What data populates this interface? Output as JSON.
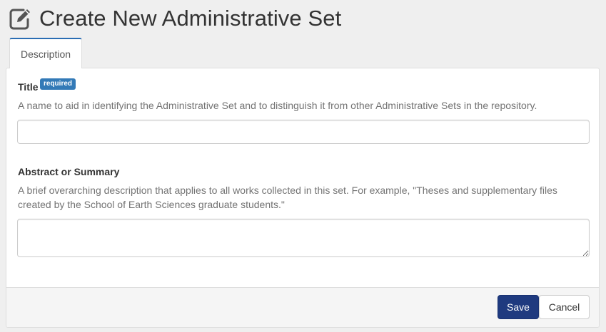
{
  "header": {
    "title": "Create New Administrative Set",
    "icon": "edit-icon"
  },
  "tabs": [
    {
      "label": "Description",
      "active": true
    }
  ],
  "form": {
    "title_field": {
      "label": "Title",
      "badge": "required",
      "help": "A name to aid in identifying the Administrative Set and to distinguish it from other Administrative Sets in the repository.",
      "value": "",
      "placeholder": ""
    },
    "abstract_field": {
      "label": "Abstract or Summary",
      "help": "A brief overarching description that applies to all works collected in this set. For example, \"Theses and supplementary files created by the School of Earth Sciences graduate students.\"",
      "value": "",
      "placeholder": ""
    }
  },
  "footer": {
    "save_label": "Save",
    "cancel_label": "Cancel"
  },
  "colors": {
    "background": "#efefef",
    "primary_button": "#1f3a7f",
    "badge": "#337ab7",
    "tab_accent": "#2a6db3"
  }
}
